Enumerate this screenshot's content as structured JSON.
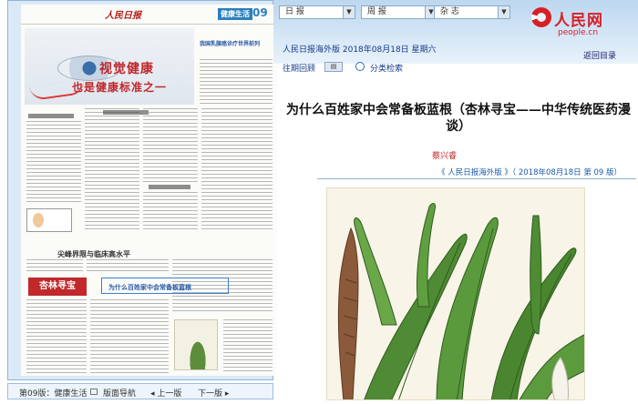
{
  "nav": {
    "selects": [
      {
        "name": "daily",
        "label": "日 报"
      },
      {
        "name": "weekly",
        "label": "周 报"
      },
      {
        "name": "magazine",
        "label": "杂 志"
      }
    ],
    "back_label": "返回目录",
    "logo_text": "人民网",
    "logo_url": "people.cn",
    "brand_color": "#d71f26"
  },
  "paper_info": {
    "edition_date": "人民日报海外版  2018年08月18日  星期六"
  },
  "tools": {
    "prev_issues": "往期回顾",
    "search": "分类检索"
  },
  "newspaper": {
    "logo": "人民日报",
    "section_badge": "健康生活",
    "page_num": "09",
    "hero_line1": "视觉健康",
    "hero_line2": "也是健康标准之一",
    "side_title": "我国乳腺癌诊疗世界前列",
    "bottom_head": "尖峰界限与临床高水平",
    "stamp_text": "杏林寻宝",
    "story_head": "为什么百姓家中会常备板蓝根"
  },
  "paper_bar": {
    "page_label": "第09版：健康生活",
    "directory": "版面导航",
    "prev": "上一版",
    "next": "下一版"
  },
  "article": {
    "title": "为什么百姓家中会常备板蓝根（杏林寻宝——中华传统医药漫谈）",
    "author": "蔡兴睿",
    "source": "《 人民日报海外版 》（ 2018年08月18日   第 09 版）"
  }
}
